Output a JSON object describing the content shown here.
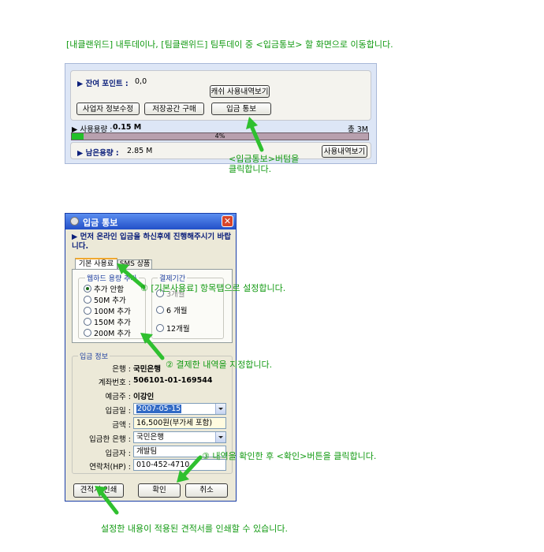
{
  "instruction_top": "[내클랜위드] 내투데이나, [팀클랜위드] 팀투데이 중 <입금통보> 할 화면으로 이동합니다.",
  "panel": {
    "cash_point_label": "▶ 잔여 포인트 :",
    "cash_point_value": "0,0",
    "cash_history_button": "캐쉬 사용내역보기",
    "edit_business_button": "사업자 정보수정",
    "buy_storage_button": "저장공간 구매",
    "deposit_notice_button": "입금 통보",
    "usage_label": "▶ 사용용량 :",
    "usage_value": "0.15 M",
    "total_label": "총 3M",
    "progress_text": "4%",
    "progress_percent": 4,
    "remaining_label": "▶ 남은용량 :",
    "remaining_value": "2.85 M",
    "usage_history_button": "사용내역보기"
  },
  "callout_click": {
    "line1": "<입금통보>버텀을",
    "line2": "클릭합니다."
  },
  "dialog": {
    "title": "입금 통보",
    "notice": "▶ 먼저 온라인 입금을 하신후에  진행해주시기 바랍니다.",
    "tabs": [
      "기본 사용료",
      "SMS 상품"
    ],
    "webhard_legend": "웹하드 용량 추가",
    "webhard_options": [
      "추가 안함",
      "50M 추가",
      "100M 추가",
      "150M 추가",
      "200M 추가"
    ],
    "period_legend": "결제기간",
    "period_options": [
      "3개월",
      "6 개월",
      "12개월"
    ],
    "deposit_legend": "입금 정보",
    "fields": {
      "bank_label": "은행 :",
      "bank_value": "국민은행",
      "account_label": "계좌번호 :",
      "account_value": "506101-01-169544",
      "holder_label": "예금주 :",
      "holder_value": "이강인",
      "date_label": "입금일 :",
      "date_value": "2007-05-15",
      "amount_label": "금액 :",
      "amount_value": "16,500원(부가세 포함)",
      "from_bank_label": "입금한 은행 :",
      "from_bank_value": "국민은행",
      "depositor_label": "입금자 :",
      "depositor_value": "개발팀",
      "phone_label": "연락처(HP) :",
      "phone_value": "010-452-4710"
    },
    "print_button": "견적서 인쇄",
    "confirm_button": "확인",
    "cancel_button": "취소"
  },
  "steps": {
    "step1": "① [기본사용료] 항목탭으로 설정합니다.",
    "step2": "② 결제한 내역을 지정합니다.",
    "step3": "③ 내역을 확인한 후 <확인>버튼을 클릭합니다."
  },
  "instruction_bottom": "설정한 내용이 적용된 견적서를 인쇄할 수 있습니다.",
  "colors": {
    "accent_green": "#129a12",
    "dialog_title_bar": "#2b57c8",
    "close_button": "#d8452a",
    "progress_fill": "#22c02a",
    "progress_track": "#b8a0ae"
  }
}
